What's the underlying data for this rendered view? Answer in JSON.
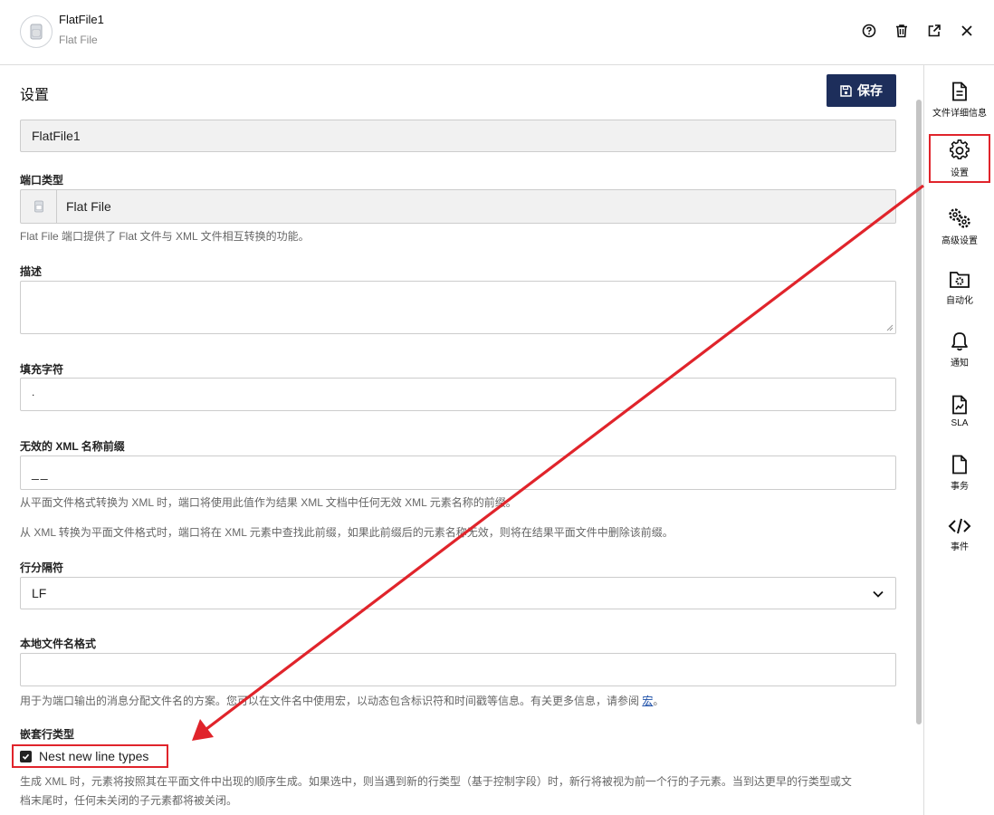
{
  "header": {
    "title": "FlatFile1",
    "subtitle": "Flat File"
  },
  "settings": {
    "title": "设置",
    "save_label": "保存"
  },
  "fields": {
    "name_value": "FlatFile1",
    "port_type_label": "端口类型",
    "port_type_value": "Flat File",
    "port_type_help": "Flat File 端口提供了 Flat 文件与 XML 文件相互转换的功能。",
    "description_label": "描述",
    "description_value": "",
    "padding_label": "填充字符",
    "padding_value": ".",
    "invalid_prefix_label": "无效的 XML 名称前缀",
    "invalid_prefix_value": "__",
    "invalid_prefix_help1": "从平面文件格式转换为 XML 时，端口将使用此值作为结果 XML 文档中任何无效 XML 元素名称的前缀。",
    "invalid_prefix_help2": "从 XML 转换为平面文件格式时，端口将在 XML 元素中查找此前缀，如果此前缀后的元素名称无效，则将在结果平面文件中删除该前缀。",
    "row_separator_label": "行分隔符",
    "row_separator_value": "LF",
    "local_filename_label": "本地文件名格式",
    "local_filename_value": "",
    "local_filename_help": "用于为端口输出的消息分配文件名的方案。您可以在文件名中使用宏，以动态包含标识符和时间戳等信息。有关更多信息，请参阅",
    "local_filename_link": "宏",
    "local_filename_help_end": "。",
    "nested_label": "嵌套行类型",
    "nested_checkbox_label": "Nest new line types",
    "nested_help1": "生成 XML 时，元素将按照其在平面文件中出现的顺序生成。如果选中，则当遇到新的行类型（基于控制字段）时，新行将被视为前一个行的子元素。当到达更早的行类型或文",
    "nested_help2": "档末尾时，任何未关闭的子元素都将被关闭。"
  },
  "sidebar": {
    "items": [
      {
        "label": "文件详细信息",
        "icon": "document-icon"
      },
      {
        "label": "设置",
        "icon": "gear-icon"
      },
      {
        "label": "高级设置",
        "icon": "gears-icon"
      },
      {
        "label": "自动化",
        "icon": "folder-gear-icon"
      },
      {
        "label": "通知",
        "icon": "bell-icon"
      },
      {
        "label": "SLA",
        "icon": "sla-document-icon"
      },
      {
        "label": "事务",
        "icon": "file-icon"
      },
      {
        "label": "事件",
        "icon": "code-icon"
      }
    ]
  },
  "colors": {
    "accent": "#1d2e5b",
    "annotation": "#e0242b"
  }
}
